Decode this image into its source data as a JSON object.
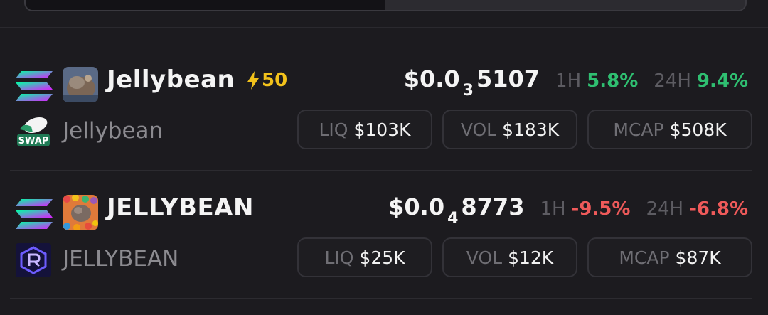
{
  "rows": [
    {
      "name": "Jellybean",
      "boost": "50",
      "subname": "Jellybean",
      "dex_icon": "swap-icon",
      "dex_label": "SWAP",
      "price_prefix": "$0.0",
      "price_zeros": "3",
      "price_digits": "5107",
      "h1_label": "1H",
      "h1_value": "5.8%",
      "h24_label": "24H",
      "h24_value": "9.4%",
      "liq_label": "LIQ",
      "liq_value": "$103K",
      "vol_label": "VOL",
      "vol_value": "$183K",
      "mcap_label": "MCAP",
      "mcap_value": "$508K",
      "change_color": "#2fbf71"
    },
    {
      "name": "JELLYBEAN",
      "subname": "JELLYBEAN",
      "dex_icon": "raydium-icon",
      "price_prefix": "$0.0",
      "price_zeros": "4",
      "price_digits": "8773",
      "h1_label": "1H",
      "h1_value": "-9.5%",
      "h24_label": "24H",
      "h24_value": "-6.8%",
      "liq_label": "LIQ",
      "liq_value": "$25K",
      "vol_label": "VOL",
      "vol_value": "$12K",
      "mcap_label": "MCAP",
      "mcap_value": "$87K",
      "change_color": "#ef5a5a"
    }
  ],
  "chain_icon": "solana-icon",
  "boost_icon": "lightning-icon",
  "colors": {
    "background": "#1c1b1f",
    "positive": "#2fbf71",
    "negative": "#ef5a5a",
    "boost": "#f2c21b"
  }
}
